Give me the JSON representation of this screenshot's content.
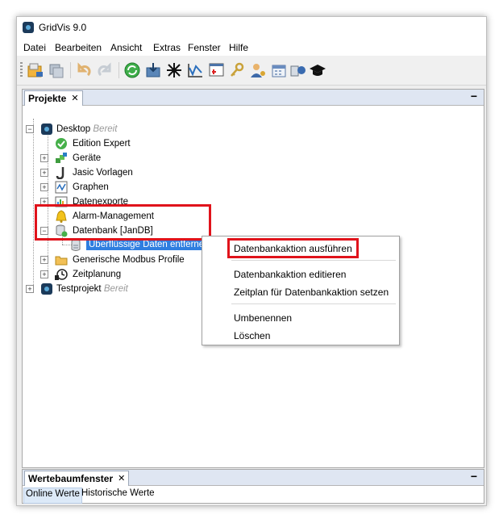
{
  "window": {
    "title": "GridVis 9.0"
  },
  "menu": [
    "Datei",
    "Bearbeiten",
    "Ansicht",
    "Extras",
    "Fenster",
    "Hilfe"
  ],
  "toolbar_icons": [
    "new-project-icon",
    "save-icon",
    "undo-icon",
    "redo-icon",
    "refresh-icon",
    "import-icon",
    "topology-icon",
    "graph-icon",
    "report-icon",
    "key-icon",
    "user-icon",
    "calendar-icon",
    "devices-icon",
    "academy-icon"
  ],
  "projects_panel": {
    "tab_label": "Projekte",
    "close": "✕",
    "minimize": "−",
    "tree": {
      "desktop": {
        "label": "Desktop",
        "status": "Bereit"
      },
      "children": [
        {
          "label": "Edition Expert"
        },
        {
          "label": "Geräte"
        },
        {
          "label": "Jasic Vorlagen"
        },
        {
          "label": "Graphen"
        },
        {
          "label": "Datenexporte"
        },
        {
          "label": "Alarm-Management"
        },
        {
          "label": "Datenbank [JanDB]"
        },
        {
          "label": "Überflüssige Daten entfernen"
        },
        {
          "label": "Generische Modbus Profile"
        },
        {
          "label": "Zeitplanung"
        }
      ],
      "testproject": {
        "label": "Testprojekt",
        "status": "Bereit"
      }
    }
  },
  "context_menu": {
    "items": [
      "Datenbankaktion ausführen",
      "Datenbankaktion editieren",
      "Zeitplan für Datenbankaktion setzen",
      "Umbenennen",
      "Löschen"
    ]
  },
  "values_panel": {
    "tab_label": "Wertebaumfenster",
    "close": "✕",
    "minimize": "−",
    "tabs": [
      "Online Werte",
      "Historische Werte"
    ]
  },
  "colors": {
    "selection": "#2f7ee0",
    "highlight": "#e0131b",
    "panel_header": "#dfe6f2"
  }
}
